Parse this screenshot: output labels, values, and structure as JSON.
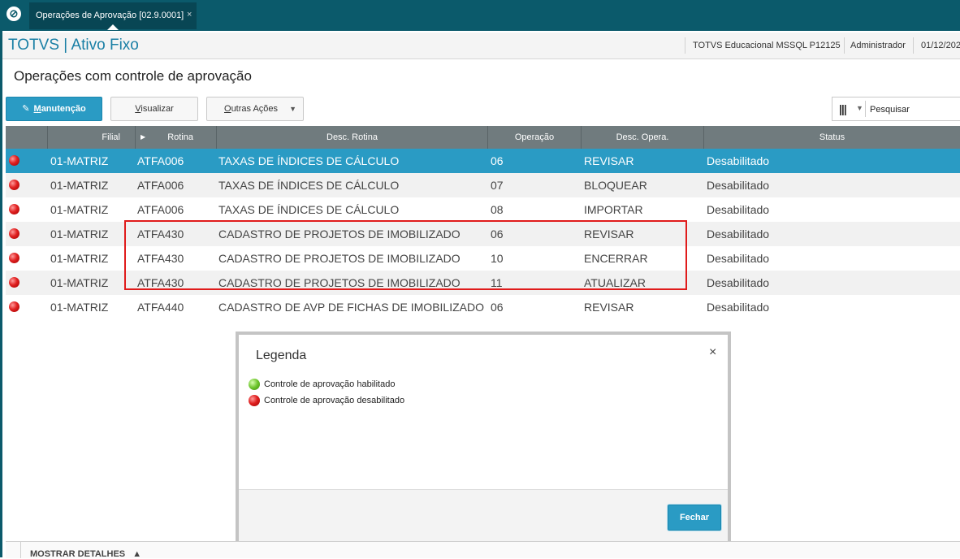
{
  "tabbar": {
    "tab_label": "Operações de Aprovação [02.9.0001]",
    "tab_close": "×"
  },
  "header": {
    "app_title": "TOTVS | Ativo Fixo",
    "environment": "TOTVS Educacional MSSQL P12125",
    "user": "Administrador",
    "date": "01/12/202"
  },
  "page": {
    "title": "Operações com controle de aprovação"
  },
  "toolbar": {
    "manutencao_first": "M",
    "manutencao_rest": "anutenção",
    "visualizar_first": "V",
    "visualizar_rest": "isualizar",
    "outras_first": "O",
    "outras_rest": "utras Ações",
    "search_placeholder": "Pesquisar"
  },
  "grid": {
    "columns": [
      "Filial",
      "Rotina",
      "Desc. Rotina",
      "Operação",
      "Desc. Opera.",
      "Status"
    ],
    "rows": [
      {
        "filial": "01-MATRIZ",
        "rotina": "ATFA006",
        "desc_rotina": "TAXAS DE ÍNDICES DE CÁLCULO",
        "operacao": "06",
        "desc_opera": "REVISAR",
        "status": "Desabilitado"
      },
      {
        "filial": "01-MATRIZ",
        "rotina": "ATFA006",
        "desc_rotina": "TAXAS DE ÍNDICES DE CÁLCULO",
        "operacao": "07",
        "desc_opera": "BLOQUEAR",
        "status": "Desabilitado"
      },
      {
        "filial": "01-MATRIZ",
        "rotina": "ATFA006",
        "desc_rotina": "TAXAS DE ÍNDICES DE CÁLCULO",
        "operacao": "08",
        "desc_opera": "IMPORTAR",
        "status": "Desabilitado"
      },
      {
        "filial": "01-MATRIZ",
        "rotina": "ATFA430",
        "desc_rotina": "CADASTRO DE PROJETOS DE IMOBILIZADO",
        "operacao": "06",
        "desc_opera": "REVISAR",
        "status": "Desabilitado"
      },
      {
        "filial": "01-MATRIZ",
        "rotina": "ATFA430",
        "desc_rotina": "CADASTRO DE PROJETOS DE IMOBILIZADO",
        "operacao": "10",
        "desc_opera": "ENCERRAR",
        "status": "Desabilitado"
      },
      {
        "filial": "01-MATRIZ",
        "rotina": "ATFA430",
        "desc_rotina": "CADASTRO DE PROJETOS DE IMOBILIZADO",
        "operacao": "11",
        "desc_opera": "ATUALIZAR",
        "status": "Desabilitado"
      },
      {
        "filial": "01-MATRIZ",
        "rotina": "ATFA440",
        "desc_rotina": "CADASTRO DE AVP DE FICHAS DE IMOBILIZADO",
        "operacao": "06",
        "desc_opera": "REVISAR",
        "status": "Desabilitado"
      }
    ],
    "selected_row": 0
  },
  "legend_dialog": {
    "title": "Legenda",
    "close_symbol": "×",
    "items": [
      {
        "label": "Controle de aprovação habilitado",
        "color": "green"
      },
      {
        "label": "Controle de aprovação desabilitado",
        "color": "red"
      }
    ],
    "close_button": "Fechar"
  },
  "bottom": {
    "details_label": "MOSTRAR DETALHES",
    "details_arrow": "▲"
  },
  "colors": {
    "accent": "#2a9bc4",
    "topbar": "#0b5a6b",
    "header_grid": "#707b7e",
    "highlight": "#e01b1b"
  }
}
